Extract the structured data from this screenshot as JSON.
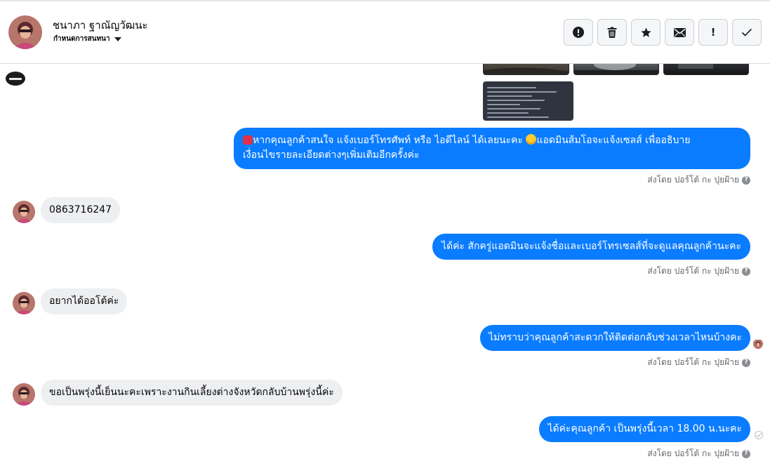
{
  "header": {
    "contact_name": "ชนาภา ฐาณัญวัฒนะ",
    "assign_label": "กำหนดการสนทนา",
    "actions": [
      {
        "icon": "alert-circle-icon"
      },
      {
        "icon": "trash-icon"
      },
      {
        "icon": "star-icon"
      },
      {
        "icon": "envelope-icon"
      },
      {
        "icon": "exclamation-icon",
        "glyph": "!"
      },
      {
        "icon": "check-icon"
      }
    ]
  },
  "thread": {
    "msg1_line1": "หากคุณลูกค้าสนใจ แจ้งเบอร์โทรศัพท์ หรือ ไอดีไลน์  ได้เลยนะคะ ",
    "msg1_line1b": "แอดมินส้มโอจะแจ้งเซลส์   เพื่ออธิบาย",
    "msg1_line2": "เงื่อนไขรายละเอียดต่างๆเพิ่มเติมอีกครั้งค่ะ",
    "msg2": "0863716247",
    "msg3": "ได้ค่ะ สักครู่แอดมินจะแจ้งชื่อและเบอร์โทรเซลส์ที่จะดูแลคุณลูกค้านะคะ",
    "msg4": "อยากได้ออโต้ค่ะ",
    "msg5": "ไม่ทราบว่าคุณลูกค้าสะดวกให้ติดต่อกลับช่วงเวลาไหนบ้างคะ",
    "msg6": "ขอเป็นพรุ่งนี้เย็นนะคะเพราะงานกินเลี้ยงต่างจังหวัดกลับบ้านพรุ่งนี้ค่ะ",
    "msg7": "ได้ค่ะคุณลูกค้า เป็นพรุ่งนี้เวลา 18.00 น.นะคะ",
    "sent_by": "ส่งโดย ปอร์โต้ กะ ปุยฝ้าย",
    "help_glyph": "?"
  },
  "colors": {
    "outgoing_bubble": "#0a7cff",
    "incoming_bubble": "#eeeff1",
    "meta_text": "#65676b"
  }
}
